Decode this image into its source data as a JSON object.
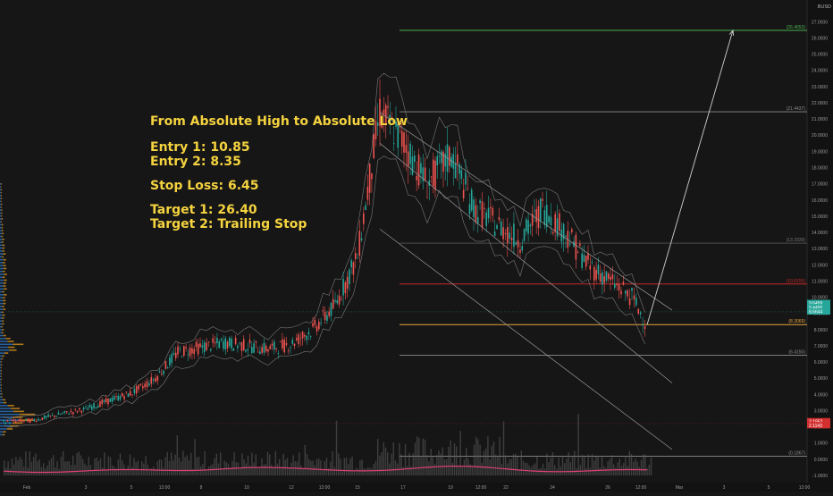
{
  "chart_data": {
    "type": "line",
    "title": "",
    "currency": "BUSD",
    "ylim": [
      -1.0,
      28.0
    ],
    "y_ticks": [
      "-1.0000",
      "0.0000",
      "1.0000",
      "2.0000",
      "3.0000",
      "4.0000",
      "5.0000",
      "6.0000",
      "7.0000",
      "8.0000",
      "9.0000",
      "10.0000",
      "11.0000",
      "12.0000",
      "13.0000",
      "14.0000",
      "15.0000",
      "16.0000",
      "17.0000",
      "18.0000",
      "19.0000",
      "20.0000",
      "21.0000",
      "22.0000",
      "23.0000",
      "24.0000",
      "25.0000",
      "26.0000",
      "27.0000"
    ],
    "x_ticks": [
      "Feb",
      "3",
      "5",
      "12:00",
      "8",
      "10",
      "12",
      "12:00",
      "15",
      "17",
      "19",
      "12:00",
      "22",
      "24",
      "26",
      "12:00",
      "Mar",
      "3",
      "5",
      "12:00"
    ],
    "horizontal_levels": [
      {
        "label": "(26.4653)",
        "value": 26.4653,
        "color": "#4caf50"
      },
      {
        "label": "(21.4437)",
        "value": 21.4437,
        "color": "#8c8c8c"
      },
      {
        "label": "(13.3339)",
        "value": 13.3339,
        "color": "#555555"
      },
      {
        "label": "(10.8155)",
        "value": 10.8155,
        "color": "#c62828"
      },
      {
        "label": "(8.3069)",
        "value": 8.3069,
        "color": "#e6a23c"
      },
      {
        "label": "(6.4150)",
        "value": 6.415,
        "color": "#8c8c8c"
      },
      {
        "label": "(0.1867)",
        "value": 0.1867,
        "color": "#8c8c8c"
      }
    ],
    "price_labels": [
      {
        "text": "9.6459",
        "value": 9.6459,
        "color": "#26a69a"
      },
      {
        "text": "9.4490",
        "value": 9.38,
        "color": "#26a69a"
      },
      {
        "text": "8.6644",
        "value": 9.12,
        "color": "#26a69a"
      },
      {
        "text": "2.1952",
        "value": 2.35,
        "color": "#d32f2f"
      },
      {
        "text": "2.1143",
        "value": 2.1,
        "color": "#d32f2f"
      }
    ],
    "series": [
      {
        "x": [
          0,
          1,
          2,
          3,
          4,
          5,
          6,
          7,
          8,
          9,
          10,
          11,
          12,
          13,
          14,
          15,
          16,
          17,
          18,
          19,
          20,
          21,
          22,
          23,
          24,
          25,
          26,
          27,
          28
        ],
        "values": [
          2.3,
          2.4,
          2.8,
          3.1,
          3.6,
          4.1,
          5.0,
          6.6,
          6.9,
          7.2,
          7.0,
          6.8,
          7.1,
          8.0,
          9.5,
          12.5,
          21.4,
          19.5,
          17.0,
          18.8,
          15.5,
          14.5,
          13.5,
          15.5,
          14.0,
          12.0,
          11.0,
          10.0,
          8.3
        ]
      },
      {
        "x": [
          28,
          36
        ],
        "values": [
          8.3,
          26.4653
        ]
      }
    ]
  },
  "annotation": {
    "title": "From Absolute High to Absolute Low",
    "entry1": "Entry 1: 10.85",
    "entry2": "Entry 2: 8.35",
    "stop": "Stop Loss: 6.45",
    "target1": "Target 1: 26.40",
    "target2": "Target 2: Trailing Stop"
  }
}
